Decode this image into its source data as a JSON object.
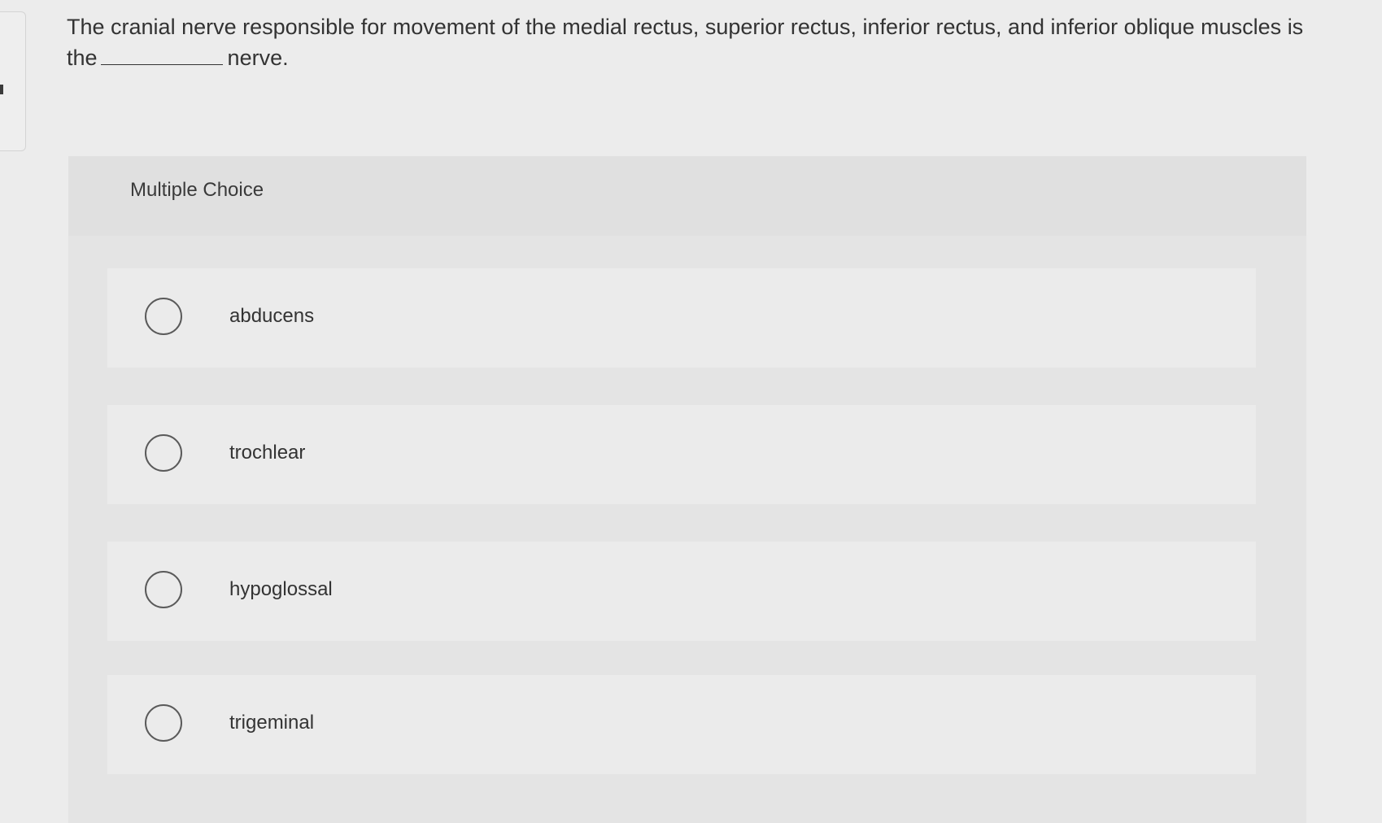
{
  "question": {
    "text_before_blank": "The cranial nerve responsible for movement of the medial rectus, superior rectus, inferior rectus, and inferior oblique muscles is the",
    "text_after_blank": "nerve."
  },
  "multiple_choice": {
    "label": "Multiple Choice",
    "options": [
      {
        "label": "abducens"
      },
      {
        "label": "trochlear"
      },
      {
        "label": "hypoglossal"
      },
      {
        "label": "trigeminal"
      }
    ]
  }
}
